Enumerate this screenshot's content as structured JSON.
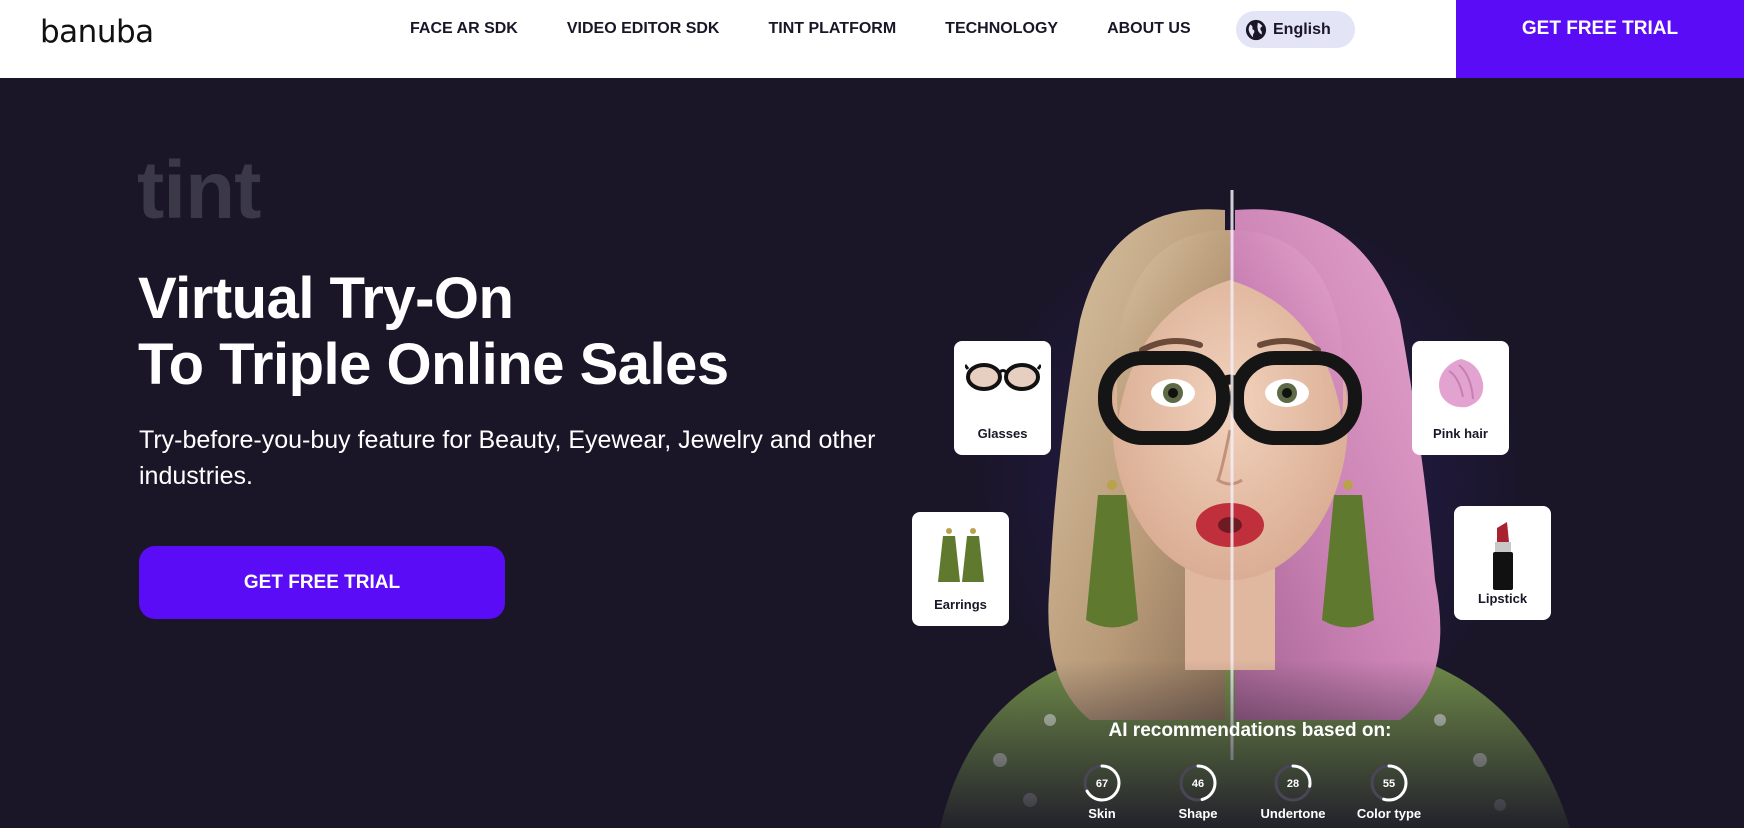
{
  "header": {
    "logo_text": "banuba",
    "nav": [
      "FACE AR SDK",
      "VIDEO EDITOR SDK",
      "TINT PLATFORM",
      "TECHNOLOGY",
      "ABOUT US"
    ],
    "language": "English",
    "cta_label": "GET FREE TRIAL"
  },
  "hero": {
    "eyebrow": "tint",
    "headline_line1": "Virtual Try-On",
    "headline_line2": "To Triple Online Sales",
    "subtitle": "Try-before-you-buy feature for Beauty, Eyewear, Jewelry and other industries.",
    "cta_label": "GET FREE TRIAL"
  },
  "cards": {
    "glasses": "Glasses",
    "pink_hair": "Pink hair",
    "earrings": "Earrings",
    "lipstick": "Lipstick"
  },
  "ai": {
    "title": "AI recommendations based on:",
    "metrics": [
      {
        "label": "Skin",
        "value": "67"
      },
      {
        "label": "Shape",
        "value": "46"
      },
      {
        "label": "Undertone",
        "value": "28"
      },
      {
        "label": "Color type",
        "value": "55"
      }
    ]
  },
  "colors": {
    "brand": "#5a0cf7",
    "background": "#1a1628",
    "lang_pill": "#e3e4f6"
  }
}
